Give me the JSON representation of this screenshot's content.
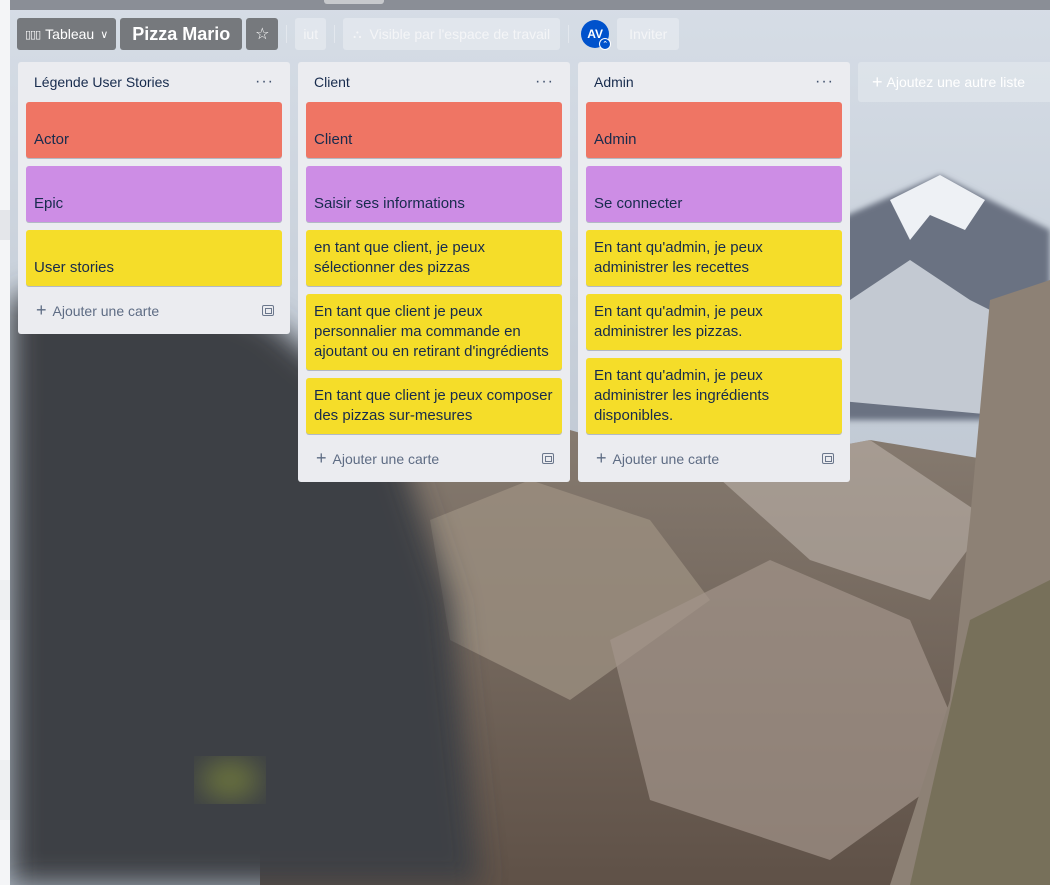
{
  "header": {
    "view_button": "Tableau",
    "board_title": "Pizza Mario",
    "star": "☆",
    "workspace": "iut",
    "visibility": "Visible par l'espace de travail",
    "avatar_initials": "AV",
    "invite": "Inviter"
  },
  "lists": [
    {
      "title": "Légende User Stories",
      "menu": "···",
      "cards": [
        {
          "text": "Actor",
          "color": "#ef7564"
        },
        {
          "text": "Epic",
          "color": "#cd8de5"
        },
        {
          "text": "User stories",
          "color": "#f5dd29"
        }
      ],
      "add_card": "Ajouter une carte"
    },
    {
      "title": "Client",
      "menu": "···",
      "cards": [
        {
          "text": "Client",
          "color": "#ef7564"
        },
        {
          "text": "Saisir ses informations",
          "color": "#cd8de5"
        },
        {
          "text": "en tant que client, je peux sélectionner des pizzas",
          "color": "#f5dd29"
        },
        {
          "text": "En tant que client je peux personnalier ma commande en ajoutant ou en retirant d'ingrédients",
          "color": "#f5dd29"
        },
        {
          "text": "En tant que client je peux composer des pizzas sur-mesures",
          "color": "#f5dd29"
        }
      ],
      "add_card": "Ajouter une carte"
    },
    {
      "title": "Admin",
      "menu": "···",
      "cards": [
        {
          "text": "Admin",
          "color": "#ef7564"
        },
        {
          "text": "Se connecter",
          "color": "#cd8de5"
        },
        {
          "text": "En tant qu'admin, je peux administrer les recettes",
          "color": "#f5dd29"
        },
        {
          "text": "En tant qu'admin, je peux administrer les pizzas.",
          "color": "#f5dd29"
        },
        {
          "text": "En tant qu'admin, je peux administrer les ingrédients disponibles.",
          "color": "#f5dd29"
        }
      ],
      "add_card": "Ajouter une carte"
    }
  ],
  "add_list": "Ajoutez une autre liste"
}
